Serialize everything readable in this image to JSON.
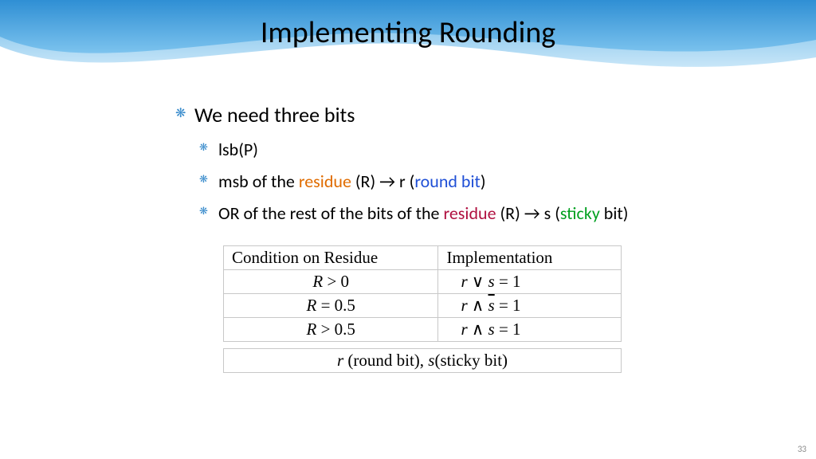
{
  "title": "Implementing Rounding",
  "bullets": {
    "main": "We need three bits",
    "b1": "lsb(P)",
    "b2_pre": "msb of the ",
    "b2_residue": "residue",
    "b2_mid": " (R) → r (",
    "b2_round": "round bit",
    "b2_post": ")",
    "b3_pre": "OR of the rest of the bits of the ",
    "b3_residue": "residue",
    "b3_mid": " (R) → s (",
    "b3_sticky": "sticky",
    "b3_post": " bit)"
  },
  "table": {
    "h1": "Condition on Residue",
    "h2": "Implementation",
    "rows": [
      {
        "cond_var": "R",
        "cond_rest": " > 0",
        "impl_pre": "r",
        "impl_op": " ∨ ",
        "impl_s": "s",
        "impl_post": " = 1",
        "sbar": false
      },
      {
        "cond_var": "R",
        "cond_rest": " = 0.5",
        "impl_pre": "r",
        "impl_op": " ∧ ",
        "impl_s": "s",
        "impl_post": " = 1",
        "sbar": true
      },
      {
        "cond_var": "R",
        "cond_rest": " > 0.5",
        "impl_pre": "r",
        "impl_op": " ∧ ",
        "impl_s": "s",
        "impl_post": " = 1",
        "sbar": false
      }
    ],
    "legend_r": "r",
    "legend_rtxt": " (round bit), ",
    "legend_s": "s",
    "legend_stxt": "(sticky bit)"
  },
  "pagenum": "33"
}
